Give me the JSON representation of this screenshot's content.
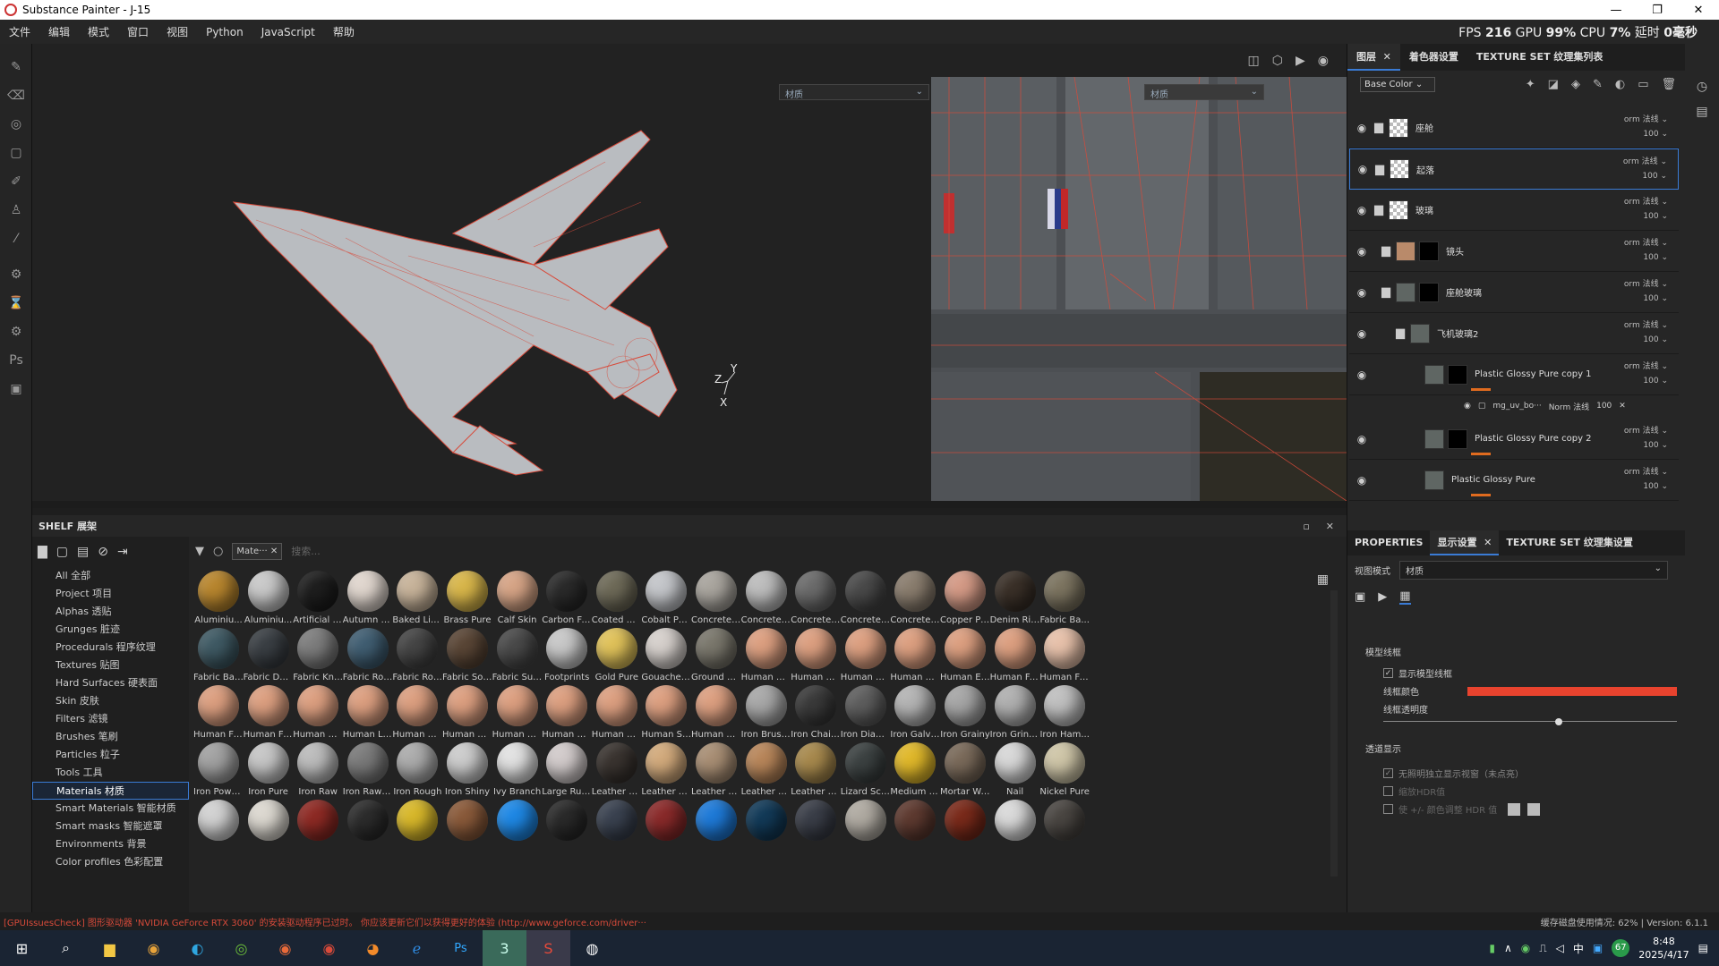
{
  "window": {
    "title": "Substance Painter - J-15",
    "min": "—",
    "max": "❐",
    "close": "✕"
  },
  "menu": {
    "items": [
      "文件",
      "编辑",
      "模式",
      "窗口",
      "视图",
      "Python",
      "JavaScript",
      "帮助"
    ]
  },
  "stats": {
    "fps_label": "FPS",
    "fps": "216",
    "gpu_label": "GPU",
    "gpu": "99%",
    "cpu_label": "CPU",
    "cpu": "7%",
    "lag_label": "延时",
    "lag": "0毫秒"
  },
  "viewport": {
    "left_mode": "材质",
    "right_mode": "材质"
  },
  "shelf": {
    "title": "SHELF 展架",
    "filter_chip": "Mate···",
    "search_placeholder": "搜索...",
    "categories": [
      "All 全部",
      "Project 项目",
      "Alphas 透贴",
      "Grunges 脏迹",
      "Procedurals 程序纹理",
      "Textures 贴图",
      "Hard Surfaces 硬表面",
      "Skin 皮肤",
      "Filters 滤镜",
      "Brushes 笔刷",
      "Particles 粒子",
      "Tools 工具",
      "Materials 材质",
      "Smart Materials 智能材质",
      "Smart masks 智能遮罩",
      "Environments 背景",
      "Color profiles 色彩配置"
    ],
    "selected_category": "Materials 材质",
    "materials": [
      {
        "label": "Aluminiu...",
        "color": "#b8862e"
      },
      {
        "label": "Aluminiu...",
        "color": "#c9c9c9"
      },
      {
        "label": "Artificial L...",
        "color": "#1e1e1e"
      },
      {
        "label": "Autumn L...",
        "color": "#e0d6ce"
      },
      {
        "label": "Baked Lig...",
        "color": "#c7b39a"
      },
      {
        "label": "Brass Pure",
        "color": "#d8b64a"
      },
      {
        "label": "Calf Skin",
        "color": "#d6a486"
      },
      {
        "label": "Carbon Fi...",
        "color": "#2a2a2a"
      },
      {
        "label": "Coated M...",
        "color": "#6e6a58"
      },
      {
        "label": "Cobalt Pure",
        "color": "#c4c6ca"
      },
      {
        "label": "Concrete ...",
        "color": "#a9a59e"
      },
      {
        "label": "Concrete ...",
        "color": "#bdbdbd"
      },
      {
        "label": "Concrete ...",
        "color": "#6b6b6b"
      },
      {
        "label": "Concrete ...",
        "color": "#4a4a4a"
      },
      {
        "label": "Concrete ...",
        "color": "#8a7d6e"
      },
      {
        "label": "Copper Pure",
        "color": "#d49a86"
      },
      {
        "label": "Denim Rivet",
        "color": "#3a3028"
      },
      {
        "label": "Fabric Ba...",
        "color": "#7c7460"
      },
      {
        "label": "Fabric Bas...",
        "color": "#3f5a64"
      },
      {
        "label": "Fabric De...",
        "color": "#3a3f44"
      },
      {
        "label": "Fabric Knit...",
        "color": "#7d7d7d"
      },
      {
        "label": "Fabric Rou...",
        "color": "#405e72"
      },
      {
        "label": "Fabric Rou...",
        "color": "#454545"
      },
      {
        "label": "Fabric Soft...",
        "color": "#5a4636"
      },
      {
        "label": "Fabric Suit...",
        "color": "#4a4a4a"
      },
      {
        "label": "Footprints",
        "color": "#c8c8c8"
      },
      {
        "label": "Gold Pure",
        "color": "#e0c25a"
      },
      {
        "label": "Gouache P...",
        "color": "#d6d0cc"
      },
      {
        "label": "Ground Gr...",
        "color": "#7a776c"
      },
      {
        "label": "Human Ba...",
        "color": "#dc9f80"
      },
      {
        "label": "Human Be...",
        "color": "#dc9f80"
      },
      {
        "label": "Human Bu...",
        "color": "#dc9f80"
      },
      {
        "label": "Human Ch...",
        "color": "#dc9f80"
      },
      {
        "label": "Human Ey...",
        "color": "#dc9f80"
      },
      {
        "label": "Human Fa...",
        "color": "#dc9f80"
      },
      {
        "label": "Human Fe...",
        "color": "#e7c1aa"
      },
      {
        "label": "Human Fo...",
        "color": "#dc9f80"
      },
      {
        "label": "Human Fo...",
        "color": "#dc9f80"
      },
      {
        "label": "Human H...",
        "color": "#dc9f80"
      },
      {
        "label": "Human Le...",
        "color": "#dc9f80"
      },
      {
        "label": "Human M...",
        "color": "#dc9f80"
      },
      {
        "label": "Human N...",
        "color": "#dc9f80"
      },
      {
        "label": "Human N...",
        "color": "#dc9f80"
      },
      {
        "label": "Human N...",
        "color": "#dc9f80"
      },
      {
        "label": "Human N...",
        "color": "#dc9f80"
      },
      {
        "label": "Human Sh...",
        "color": "#dc9f80"
      },
      {
        "label": "Human W...",
        "color": "#dc9f80"
      },
      {
        "label": "Iron Brush...",
        "color": "#a8a8a8"
      },
      {
        "label": "Iron Chain...",
        "color": "#3a3a3a"
      },
      {
        "label": "Iron Diam...",
        "color": "#5e5e5e"
      },
      {
        "label": "Iron Galva...",
        "color": "#b4b4b4"
      },
      {
        "label": "Iron Grainy",
        "color": "#a6a6a6"
      },
      {
        "label": "Iron Grinded",
        "color": "#b0b0b0"
      },
      {
        "label": "Iron Ham...",
        "color": "#c0c0c0"
      },
      {
        "label": "Iron Powd...",
        "color": "#a2a2a2"
      },
      {
        "label": "Iron Pure",
        "color": "#c6c6c6"
      },
      {
        "label": "Iron Raw",
        "color": "#bcbcbc"
      },
      {
        "label": "Iron Raw ...",
        "color": "#7a7a7a"
      },
      {
        "label": "Iron Rough",
        "color": "#acacac"
      },
      {
        "label": "Iron Shiny",
        "color": "#cccccc"
      },
      {
        "label": "Ivy Branch",
        "color": "#e2e2e2"
      },
      {
        "label": "Large Rus...",
        "color": "#d2cbcb"
      },
      {
        "label": "Leather bag",
        "color": "#3a3430"
      },
      {
        "label": "Leather Bi...",
        "color": "#d2aa7c"
      },
      {
        "label": "Leather M...",
        "color": "#a88e74"
      },
      {
        "label": "Leather R...",
        "color": "#b8865a"
      },
      {
        "label": "Leather S...",
        "color": "#a7894d"
      },
      {
        "label": "Lizard Sca...",
        "color": "#3c4242"
      },
      {
        "label": "Medium A...",
        "color": "#e0b82a"
      },
      {
        "label": "Mortar Wall",
        "color": "#7a6a5a"
      },
      {
        "label": "Nail",
        "color": "#d8d8d8"
      },
      {
        "label": "Nickel Pure",
        "color": "#cfc6a8"
      },
      {
        "label": "",
        "color": "#d2d2d2"
      },
      {
        "label": "",
        "color": "#dcd8d0"
      },
      {
        "label": "",
        "color": "#8e2a24"
      },
      {
        "label": "",
        "color": "#2c2c2c"
      },
      {
        "label": "",
        "color": "#d8b82a"
      },
      {
        "label": "",
        "color": "#8a5a3a"
      },
      {
        "label": "",
        "color": "#1e88e5"
      },
      {
        "label": "",
        "color": "#2a2a2a"
      },
      {
        "label": "",
        "color": "#3a4250"
      },
      {
        "label": "",
        "color": "#8a2a2a"
      },
      {
        "label": "",
        "color": "#1e7ad8"
      },
      {
        "label": "",
        "color": "#123a58"
      },
      {
        "label": "",
        "color": "#3a3e48"
      },
      {
        "label": "",
        "color": "#b0aba2"
      },
      {
        "label": "",
        "color": "#5e3a30"
      },
      {
        "label": "",
        "color": "#7a2a1a"
      },
      {
        "label": "",
        "color": "#dadada"
      },
      {
        "label": "",
        "color": "#4a4642"
      }
    ]
  },
  "layers": {
    "tabs": [
      "图层",
      "着色器设置",
      "TEXTURE SET 纹理集列表"
    ],
    "channel": "Base Color",
    "blend_default": "orm 法线",
    "opacity": "100",
    "items": [
      {
        "name": "座舱",
        "type": "folder"
      },
      {
        "name": "起落",
        "type": "folder",
        "selected": true
      },
      {
        "name": "玻璃",
        "type": "folder"
      },
      {
        "name": "镜头",
        "type": "folder"
      },
      {
        "name": "座舱玻璃",
        "type": "folder"
      },
      {
        "name": "飞机玻璃2",
        "type": "folder"
      },
      {
        "name": "Plastic Glossy Pure copy 1",
        "type": "fill"
      },
      {
        "name": "Plastic Glossy Pure copy 2",
        "type": "fill"
      },
      {
        "name": "Plastic Glossy Pure",
        "type": "fill"
      }
    ],
    "sub": {
      "name": "mg_uv_bo···",
      "blend": "Norm 法线",
      "opacity": "100"
    }
  },
  "properties": {
    "tabs": [
      "PROPERTIES",
      "显示设置",
      "TEXTURE SET 纹理集设置"
    ],
    "view_mode_label": "视图模式",
    "view_mode": "材质",
    "wire_section": "模型线框",
    "wire_show": "显示模型线框",
    "wire_color": "线框颜色",
    "wire_opacity": "线框透明度",
    "wire_color_hex": "#e8432e",
    "wire_opacity_value": 0.6,
    "transp_section": "透道显示",
    "transp_1": "无照明独立显示视窗（未点亮）",
    "transp_2": "缩放HDR值",
    "transp_3": "使 +/- 颜色调整 HDR 值"
  },
  "status": {
    "error": "[GPUIssuesCheck] 图形驱动器 'NVIDIA GeForce RTX 3060' 的安装驱动程序已过时。 你应该更新它们以获得更好的体验 (http://www.geforce.com/driver···",
    "disk": "缓存磁盘使用情况: 62% | Version: 6.1.1"
  },
  "taskbar": {
    "time": "8:48",
    "date": "2025/4/17",
    "badge": "67"
  }
}
